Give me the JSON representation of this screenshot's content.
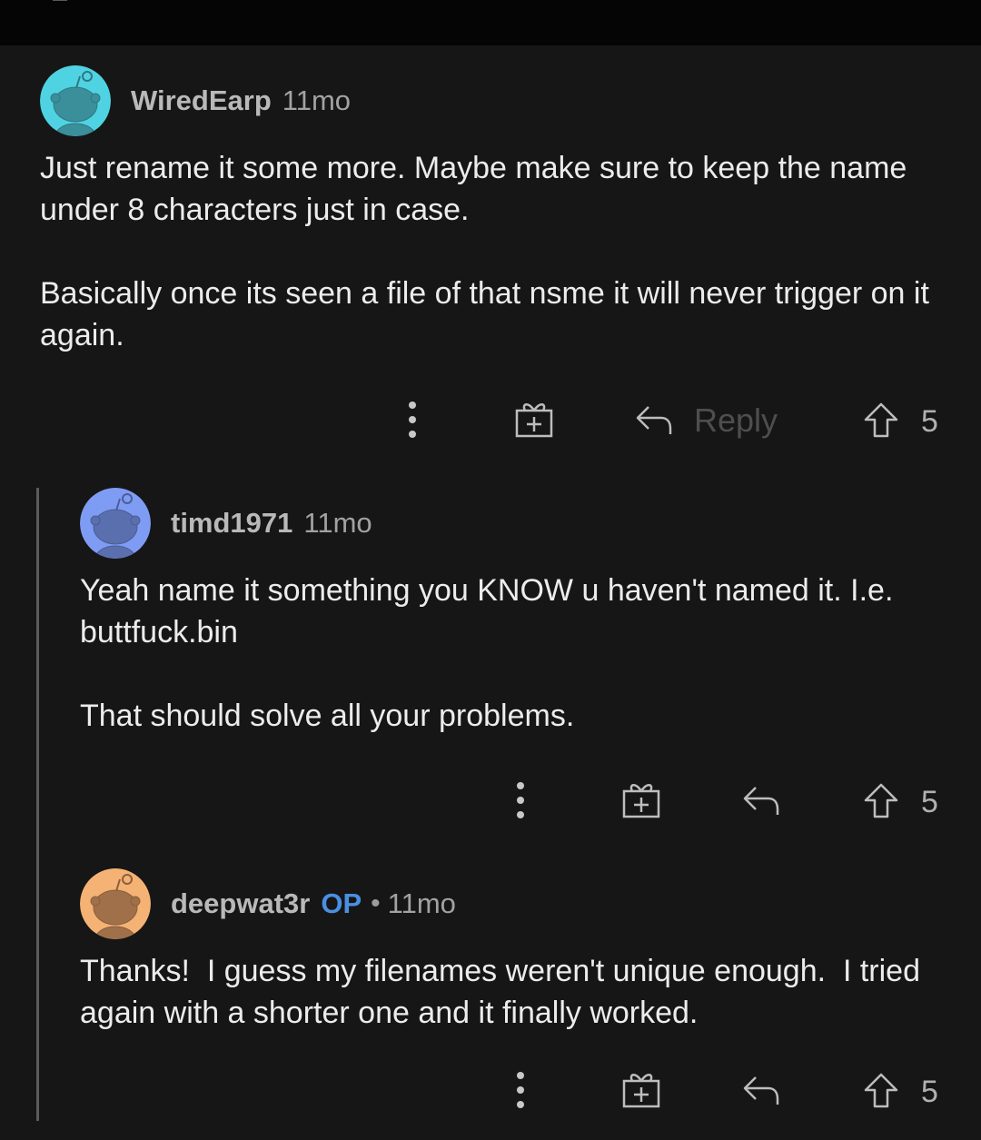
{
  "colors": {
    "background": "#161616",
    "top_bar": "#050505",
    "op_badge": "#4a90e2",
    "avatar_wiredearp": "#4fd3e3",
    "avatar_timd1971": "#7f9cf5",
    "avatar_deepwat3r": "#f5b275"
  },
  "comments": [
    {
      "username": "WiredEarp",
      "age": "11mo",
      "avatar_icon": "snoo-avatar-icon",
      "paragraphs": [
        "Just rename it some more. Maybe make sure to keep the name under 8 characters just in case.",
        "Basically once its seen a file of that nsme it will never trigger on it again."
      ],
      "reply_label": "Reply",
      "votes": "5"
    },
    {
      "username": "timd1971",
      "age": "11mo",
      "avatar_icon": "snoo-avatar-icon",
      "paragraphs": [
        "Yeah name it something you KNOW u haven't named it. I.e. buttfuck.bin",
        "That should solve all your problems."
      ],
      "votes": "5"
    },
    {
      "username": "deepwat3r",
      "op_badge": "OP",
      "separator": "•",
      "age": "11mo",
      "avatar_icon": "snoo-avatar-icon",
      "paragraphs": [
        "Thanks!  I guess my filenames weren't unique enough.  I tried again with a shorter one and it finally worked."
      ],
      "votes": "5"
    }
  ]
}
